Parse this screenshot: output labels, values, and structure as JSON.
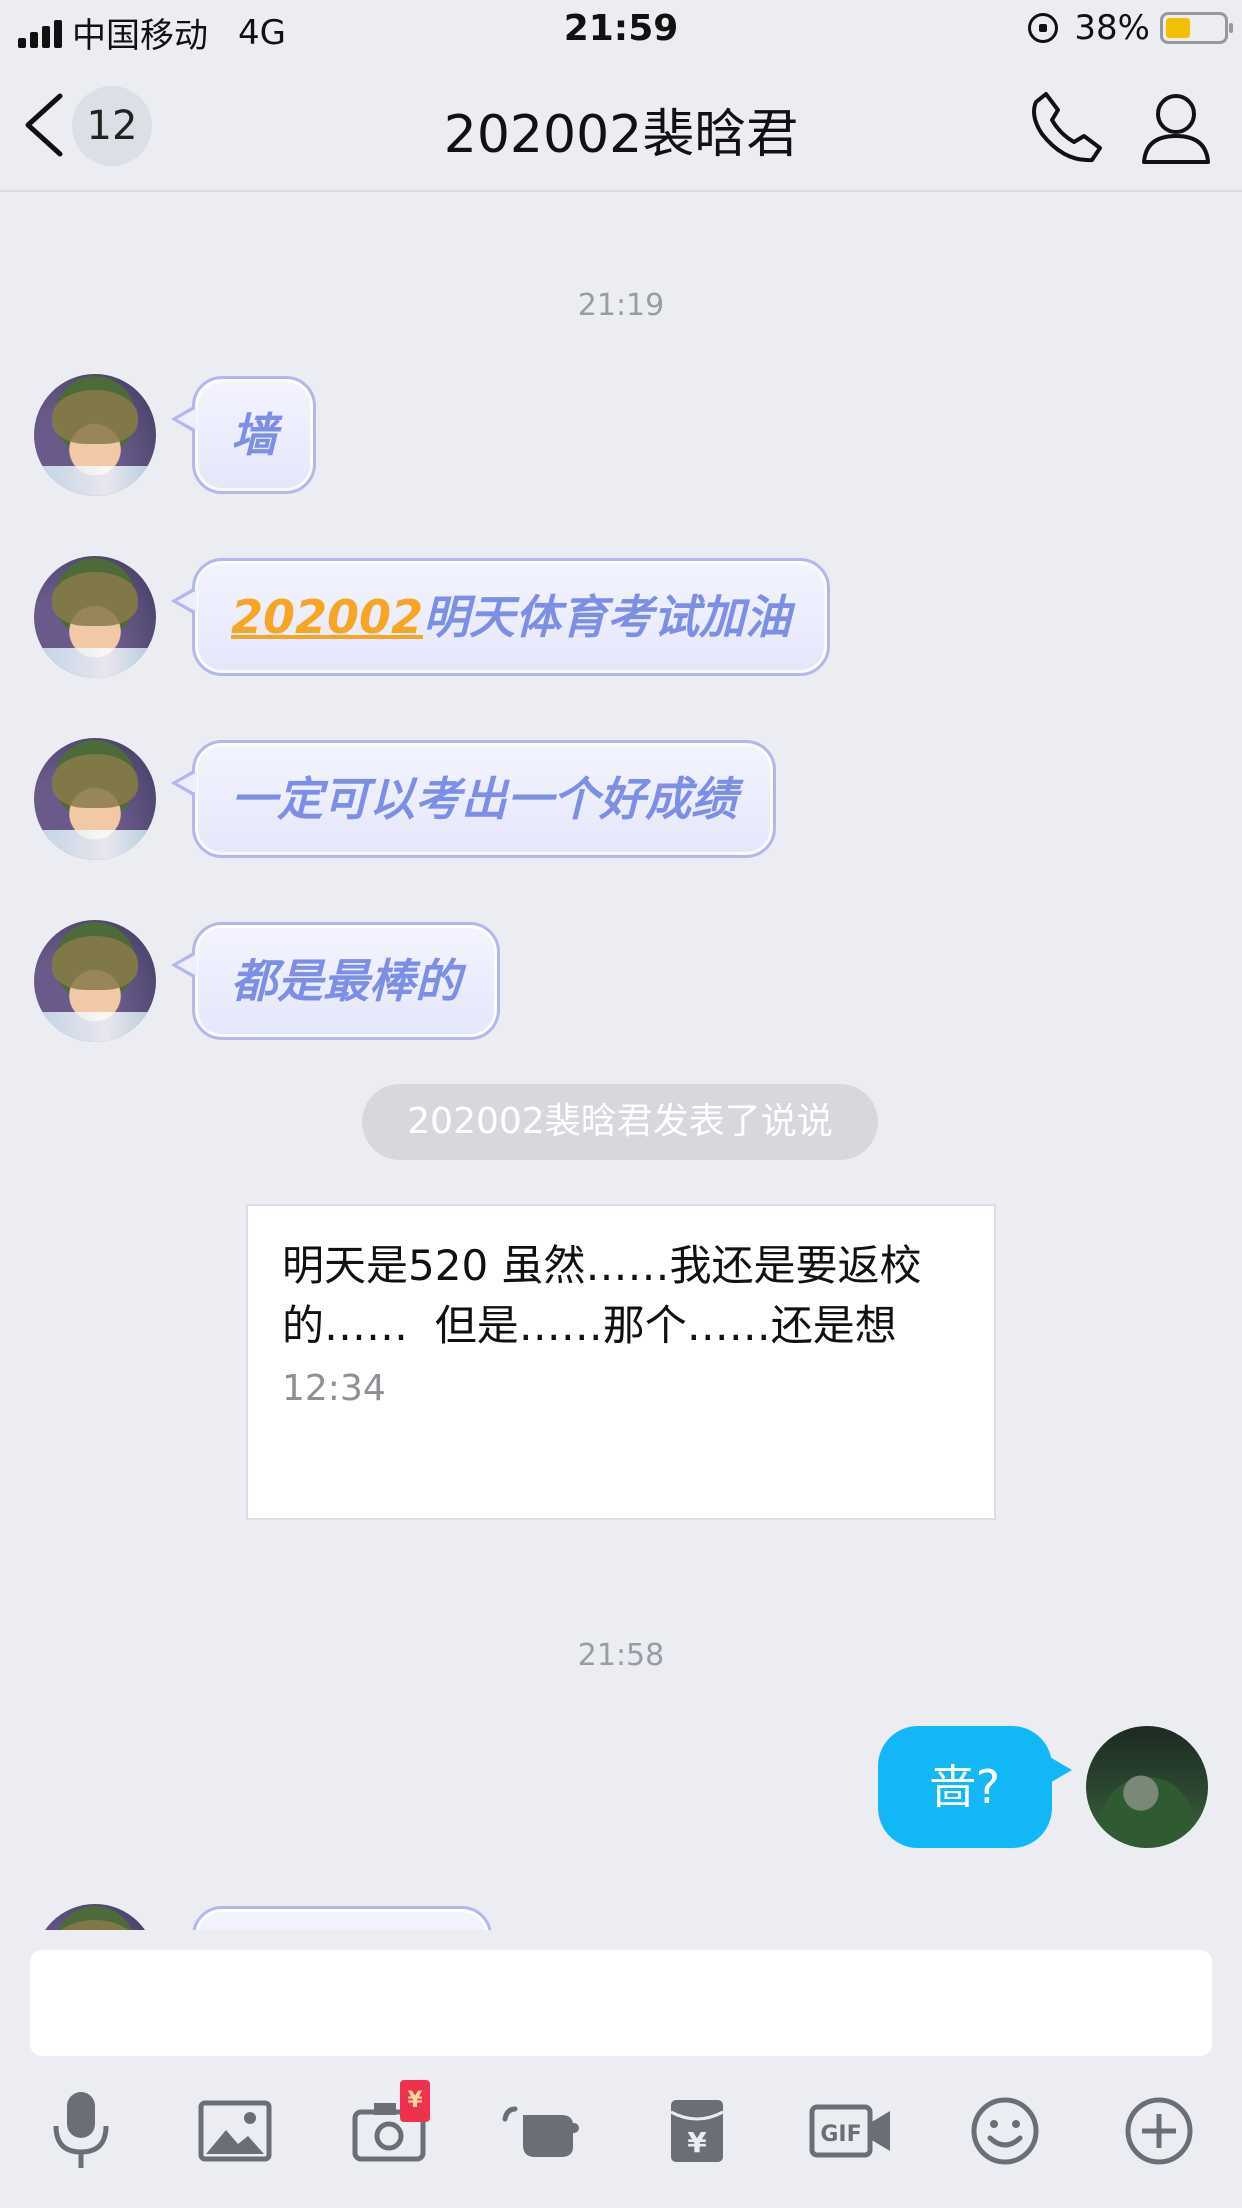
{
  "status_bar": {
    "carrier": "中国移动",
    "network": "4G",
    "time": "21:59",
    "battery": "38%",
    "battery_color": "#f2c200"
  },
  "nav": {
    "back_count": "12",
    "title": "202002裴晗君",
    "icons": [
      "back-chevron-icon",
      "phone-icon",
      "profile-icon"
    ]
  },
  "chat": {
    "timestamps": [
      "21:19",
      "21:58"
    ],
    "incoming_messages": [
      {
        "text": "墙"
      },
      {
        "mention": "202002",
        "text": "明天体育考试加油"
      },
      {
        "text": "一定可以考出一个好成绩"
      },
      {
        "text": "都是最棒的"
      }
    ],
    "system_notice": "202002裴晗君发表了说说",
    "post_card": {
      "text": "明天是520 虽然……我还是要返校的……  但是……那个……还是想",
      "time": "12:34"
    },
    "outgoing_messages": [
      {
        "text": "啬?"
      }
    ]
  },
  "colors": {
    "outgoing_bubble": "#12b7f5",
    "incoming_text": "#7d8ee6",
    "mention": "#f5a623"
  },
  "toolbar": {
    "icons": [
      "microphone-icon",
      "image-icon",
      "camera-icon",
      "poke-icon",
      "red-packet-icon",
      "gif-icon",
      "emoji-icon",
      "plus-icon"
    ],
    "red_packet_symbol": "¥",
    "gif_label": "GIF"
  }
}
